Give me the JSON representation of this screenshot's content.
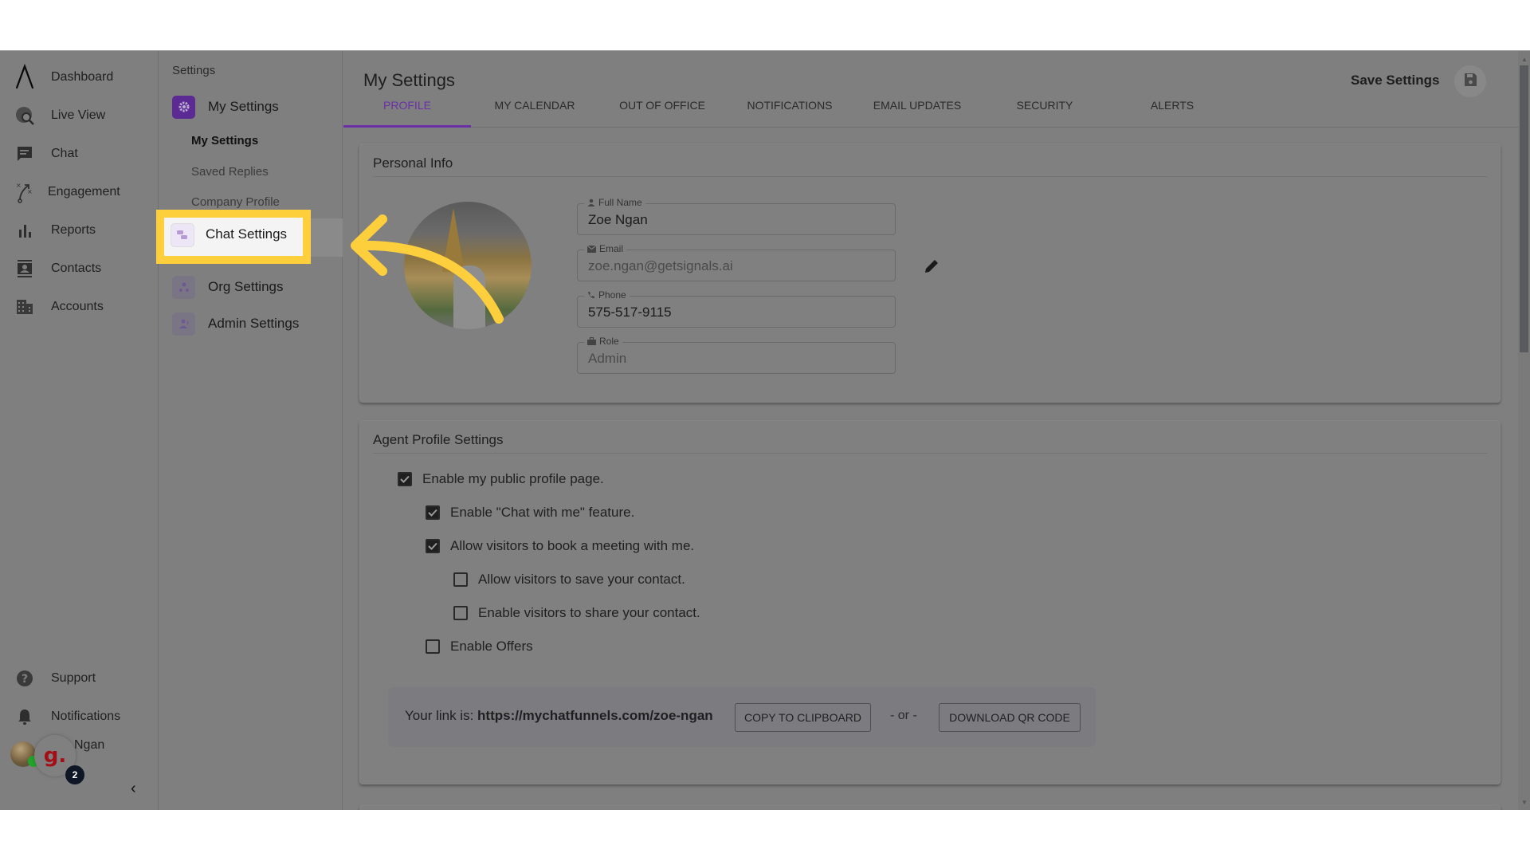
{
  "nav": {
    "items": [
      {
        "label": "Dashboard",
        "icon": "logo-icon"
      },
      {
        "label": "Live View",
        "icon": "globe-search-icon"
      },
      {
        "label": "Chat",
        "icon": "chat-icon"
      },
      {
        "label": "Engagement",
        "icon": "strategy-icon"
      },
      {
        "label": "Reports",
        "icon": "bar-chart-icon"
      },
      {
        "label": "Contacts",
        "icon": "contact-card-icon"
      },
      {
        "label": "Accounts",
        "icon": "building-icon"
      }
    ],
    "bottom": [
      {
        "label": "Support",
        "icon": "help-icon"
      },
      {
        "label": "Notifications",
        "icon": "bell-icon"
      }
    ],
    "user": {
      "name": "Ngan",
      "bubble_letter": "g.",
      "badge_count": "2"
    },
    "collapse_glyph": "‹"
  },
  "settings_panel": {
    "heading": "Settings",
    "groups": [
      {
        "label": "My Settings",
        "sub": [
          "My Settings",
          "Saved Replies",
          "Company Profile"
        ],
        "active_sub": "My Settings"
      },
      {
        "label": "Chat Settings",
        "highlighted": true
      },
      {
        "label": "Org Settings"
      },
      {
        "label": "Admin Settings"
      }
    ]
  },
  "header": {
    "title": "My Settings",
    "save_label": "Save Settings"
  },
  "tabs": [
    {
      "label": "PROFILE",
      "active": true
    },
    {
      "label": "MY CALENDAR"
    },
    {
      "label": "OUT OF OFFICE"
    },
    {
      "label": "NOTIFICATIONS"
    },
    {
      "label": "EMAIL UPDATES"
    },
    {
      "label": "SECURITY"
    },
    {
      "label": "ALERTS"
    }
  ],
  "personal_info": {
    "title": "Personal Info",
    "fields": [
      {
        "label": "Full Name",
        "value": "Zoe Ngan",
        "icon": "person-icon"
      },
      {
        "label": "Email",
        "value": "zoe.ngan@getsignals.ai",
        "icon": "mail-icon"
      },
      {
        "label": "Phone",
        "value": "575-517-9115",
        "icon": "phone-icon"
      },
      {
        "label": "Role",
        "value": "Admin",
        "icon": "briefcase-icon"
      }
    ]
  },
  "agent_profile": {
    "title": "Agent Profile Settings",
    "options": [
      {
        "label": "Enable my public profile page.",
        "checked": true,
        "level": 0
      },
      {
        "label": "Enable \"Chat with me\" feature.",
        "checked": true,
        "level": 1
      },
      {
        "label": "Allow visitors to book a meeting with me.",
        "checked": true,
        "level": 1
      },
      {
        "label": "Allow visitors to save your contact.",
        "checked": false,
        "level": 2
      },
      {
        "label": "Enable visitors to share your contact.",
        "checked": false,
        "level": 2
      },
      {
        "label": "Enable Offers",
        "checked": false,
        "level": 1
      }
    ],
    "link_prefix": "Your link is: ",
    "link_url": "https://mychatfunnels.com/zoe-ngan",
    "copy_label": "COPY TO CLIPBOARD",
    "or_label": "- or -",
    "qr_label": "DOWNLOAD QR CODE"
  },
  "colors": {
    "accent": "#6b2fa8",
    "highlight": "#fecf3c",
    "overlay_gray": "#7f7f7f"
  }
}
